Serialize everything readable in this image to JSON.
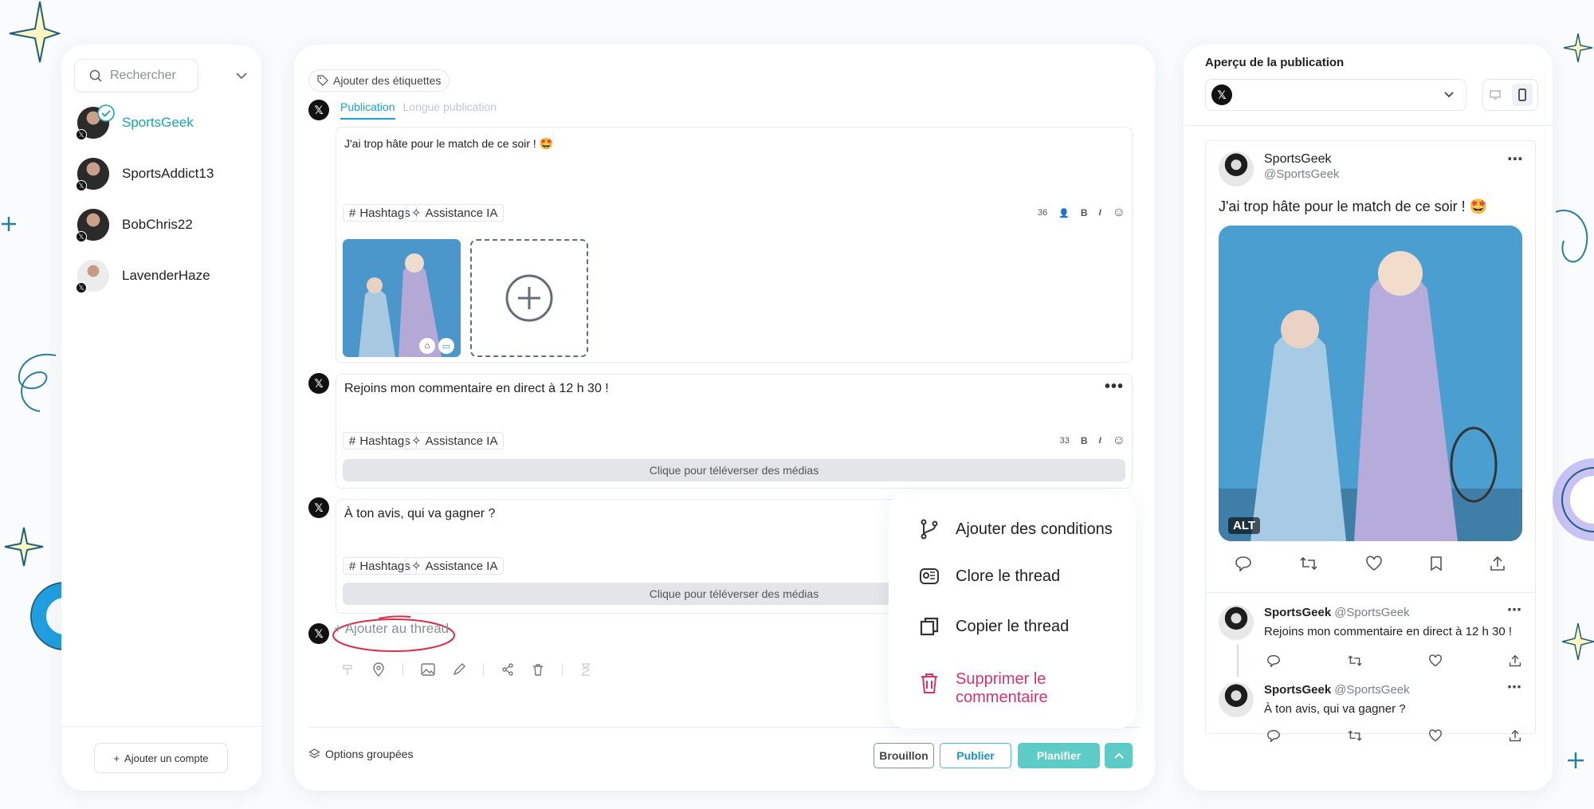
{
  "colors": {
    "accent": "#1aa3b0",
    "planifier": "#55c8c4",
    "danger": "#d6336c"
  },
  "left": {
    "search_placeholder": "Rechercher",
    "accounts": [
      {
        "name": "SportsGeek",
        "active": true
      },
      {
        "name": "SportsAddict13",
        "active": false
      },
      {
        "name": "BobChris22",
        "active": false
      },
      {
        "name": "LavenderHaze",
        "active": false
      }
    ],
    "add_account": "Ajouter un compte"
  },
  "editor": {
    "tags_button": "Ajouter des étiquettes",
    "tabs": [
      "Publication",
      "Longue publication"
    ],
    "posts": [
      {
        "text": "J'ai trop hâte pour le match de ce soir ! 🤩",
        "count": "36"
      },
      {
        "text": "Rejoins mon commentaire en direct à 12 h 30 !",
        "count": "33",
        "upload": "Clique pour téléverser des médias"
      },
      {
        "text": "À ton avis, qui va gagner ?",
        "upload": "Clique pour téléverser des médias"
      }
    ],
    "hashtags": "Hashtags",
    "ai": "Assistance IA",
    "bold": "B",
    "italic": "I",
    "add_thread": "+ Ajouter au thread",
    "grouped_options": "Options groupées",
    "btn_draft": "Brouillon",
    "btn_publish": "Publier",
    "btn_schedule": "Planifier"
  },
  "menu": {
    "items": [
      {
        "label": "Ajouter des conditions"
      },
      {
        "label": "Clore le thread"
      },
      {
        "label": "Copier le thread"
      },
      {
        "label": "Supprimer le commentaire"
      }
    ]
  },
  "preview": {
    "title": "Aperçu de la publication",
    "name": "SportsGeek",
    "handle": "@SportsGeek",
    "text": "J'ai trop hâte pour le match de ce soir ! 🤩",
    "alt": "ALT",
    "replies": [
      {
        "name": "SportsGeek",
        "handle": "@SportsGeek",
        "text": "Rejoins mon commentaire en direct à 12 h 30 !"
      },
      {
        "name": "SportsGeek",
        "handle": "@SportsGeek",
        "text": "À ton avis, qui va gagner ?"
      }
    ]
  }
}
